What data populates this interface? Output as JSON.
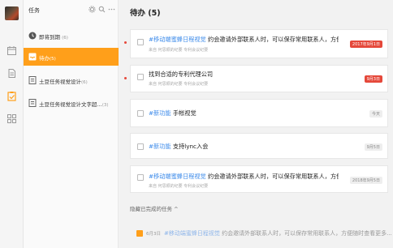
{
  "rail": {
    "icons": [
      "calendar-icon",
      "document-icon",
      "task-icon",
      "grid-icon"
    ]
  },
  "sidebar": {
    "title": "任务",
    "items": [
      {
        "label": "即将到期",
        "count": "(6)"
      },
      {
        "label": "待办",
        "count": "(5)"
      },
      {
        "label": "土豆任务视觉设计",
        "count": "(6)"
      },
      {
        "label": "土豆任务视觉设计文字超...",
        "count": "(3)"
      }
    ]
  },
  "main": {
    "title": "待办 (5)",
    "tasks": [
      {
        "tag": "#移动端蜜蜂日程视觉",
        "text": " 约会邀请外部联系人时，可以保存常用联系人，方便以后...",
        "sub": "来自 何思颖的纪要 专利会议纪要",
        "date": "2017年9月1日",
        "date_style": "red",
        "dot": true
      },
      {
        "tag": "",
        "text": "找到合适的专利代理公司",
        "sub": "来自 何思颖的纪要 专利会议纪要",
        "date": "9月3日",
        "date_style": "red",
        "dot": true
      },
      {
        "tag": "#新功能",
        "text": " 手帐视觉",
        "sub": "",
        "date": "今天",
        "date_style": "gray",
        "dot": false
      },
      {
        "tag": "#新功能",
        "text": " 支持lync入会",
        "sub": "",
        "date": "9月5日",
        "date_style": "gray",
        "dot": false
      },
      {
        "tag": "#移动端蜜蜂日程视觉",
        "text": " 约会邀请外部联系人时，可以保存常用联系人，方便以后...",
        "sub": "来自 何思颖的纪要 专利会议纪要",
        "date": "2018年9月5日",
        "date_style": "gray",
        "dot": false
      }
    ],
    "hidden_completed": "隐藏已完成的任务  ^",
    "completed": [
      {
        "date": "6月3日",
        "tag": "#移动端蜜蜂日程视觉",
        "text": " 约会邀请外部联系人时，可以保存常用联系人，方便随时查看更多..."
      }
    ]
  },
  "colors": {
    "accent": "#ff9f1a",
    "link": "#3d8bea",
    "due": "#e5483a"
  }
}
